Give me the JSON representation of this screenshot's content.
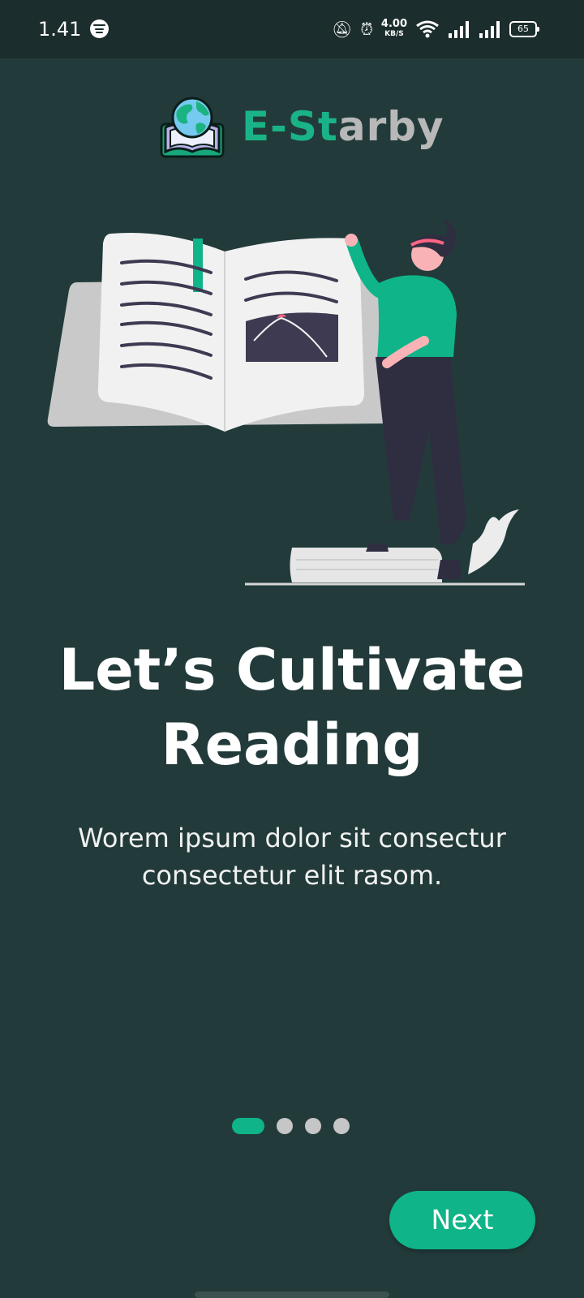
{
  "status_bar": {
    "time": "1.41",
    "net_speed_value": "4.00",
    "net_speed_unit": "KB/S",
    "battery": "65"
  },
  "brand": {
    "name_part1": "E-St",
    "name_part2": "arby",
    "accent": "#0fb488",
    "muted": "#b8b8b8"
  },
  "onboarding": {
    "title_line1": "Let’s Cultivate",
    "title_line2": "Reading",
    "subtitle": "Worem ipsum dolor sit consectur consectetur elit rasom.",
    "pages_total": 4,
    "current_page": 1
  },
  "actions": {
    "next_label": "Next"
  },
  "colors": {
    "background": "#223b3a",
    "statusbar": "#1b2d2c"
  }
}
